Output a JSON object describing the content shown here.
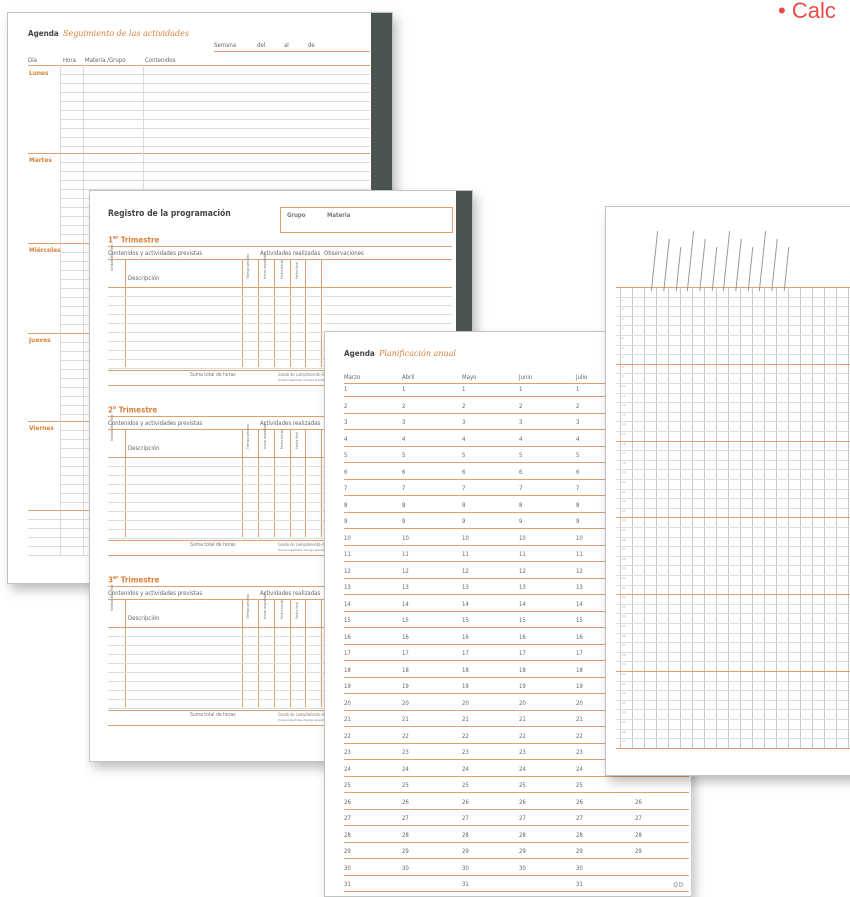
{
  "bullet": "• Calc",
  "agenda_seguimiento": {
    "title": "Agenda",
    "subtitle": "Seguimiento de las actividades",
    "week_labels": [
      "Semana",
      "del",
      "al",
      "de"
    ],
    "col_headers": [
      "Día",
      "Hora",
      "Materia /Grupo",
      "Contenidos"
    ],
    "days": [
      "Lunes",
      "Martes",
      "Miércoles",
      "Jueves",
      "Viernes"
    ]
  },
  "registro": {
    "title": "Registro de la programación",
    "box_labels": [
      "Grupo",
      "Materia"
    ],
    "trimestres": [
      {
        "name": "1",
        "sup": "er",
        "word": "Trimestre"
      },
      {
        "name": "2",
        "sup": "o",
        "word": "Trimestre"
      },
      {
        "name": "3",
        "sup": "er",
        "word": "Trimestre"
      }
    ],
    "head_left": "Contenidos y actividades previstas",
    "head_mid": "Actividades realizadas",
    "head_right": "Observaciones",
    "unidad": "Unidad didáctica",
    "descripcion": "Descripción",
    "tiempo": "Tiempo previsto",
    "horas": "Horas impartidas",
    "fecha_inicio": "Fecha inicial",
    "fecha_final": "Fecha final",
    "suma": "Suma total de horas",
    "grado": "Grado de cumplimiento de la programación",
    "grado_sub": "(horas impartidas / tiempo previsto)"
  },
  "planificacion": {
    "title": "Agenda",
    "subtitle": "Planificación anual",
    "months": [
      "Marzo",
      "Abril",
      "Mayo",
      "Junio",
      "Julio"
    ],
    "days": [
      "1",
      "2",
      "3",
      "4",
      "5",
      "6",
      "7",
      "8",
      "9",
      "10",
      "11",
      "12",
      "13",
      "14",
      "15",
      "16",
      "17",
      "18",
      "19",
      "20",
      "21",
      "22",
      "23",
      "24",
      "25",
      "26",
      "27",
      "28",
      "29",
      "30",
      "31"
    ],
    "extra_col": [
      "26",
      "27",
      "28",
      "29"
    ],
    "logo": "QD"
  }
}
